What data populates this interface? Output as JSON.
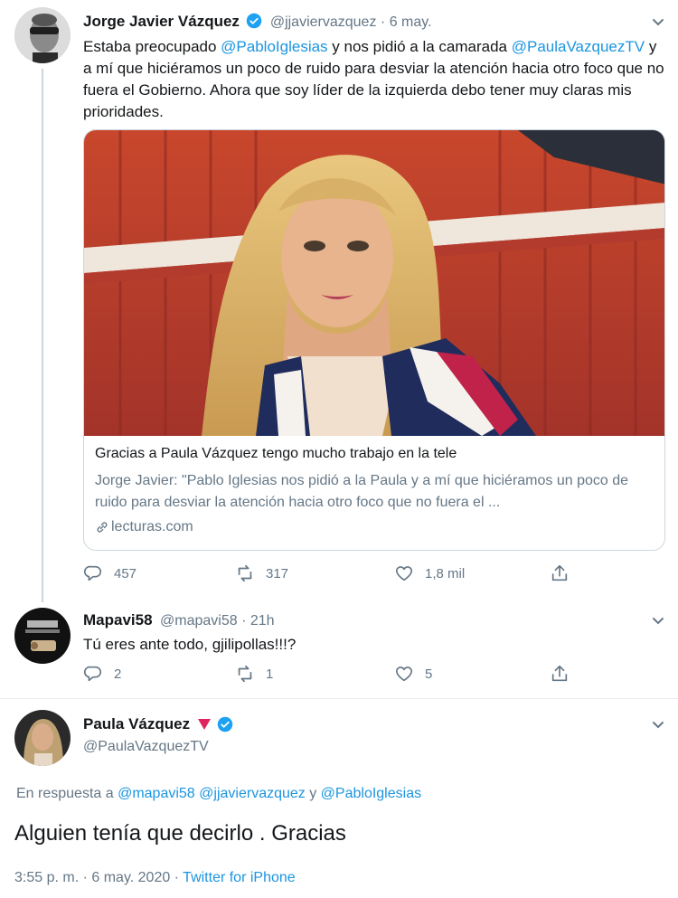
{
  "tweet1": {
    "name": "Jorge Javier Vázquez",
    "handle": "@jjaviervazquez",
    "dot": "·",
    "date": "6 may.",
    "text_1": "Estaba preocupado ",
    "mention_1": "@PabloIglesias",
    "text_2": " y nos pidió a la camarada ",
    "mention_2": "@PaulaVazquezTV",
    "text_3": " y a mí que hiciéramos un poco de ruido para desviar la atención hacia otro foco que no fuera el Gobierno. Ahora que soy líder de la izquierda debo tener muy claras mis prioridades.",
    "card": {
      "title": "Gracias a Paula Vázquez tengo mucho trabajo en la tele",
      "description": "Jorge Javier: \"Pablo Iglesias nos pidió a la Paula y a mí que hiciéramos un poco de ruido para desviar la atención hacia otro foco que no fuera el ...",
      "domain": "lecturas.com"
    },
    "replies": "457",
    "retweets": "317",
    "likes": "1,8 mil"
  },
  "tweet2": {
    "name": "Mapavi58",
    "handle": "@mapavi58",
    "dot": "·",
    "time": "21h",
    "text": "Tú eres ante todo, gjilipollas!!!?",
    "replies": "2",
    "retweets": "1",
    "likes": "5"
  },
  "tweet3": {
    "name": "Paula Vázquez",
    "handle": "@PaulaVazquezTV",
    "reply_prefix": "En respuesta a ",
    "reply_mention_1": "@mapavi58",
    "reply_mention_2": "@jjaviervazquez",
    "reply_and": " y ",
    "reply_mention_3": "@PabloIglesias",
    "text": "Alguien tenía que decirlo . Gracias",
    "timestamp": "3:55 p. m. · 6 may. 2020",
    "dot": " · ",
    "source": "Twitter for iPhone"
  },
  "colors": {
    "accent": "#1b95e0",
    "muted": "#657786",
    "verified": "#1da1f2",
    "flag": "#e0245e"
  },
  "icons": [
    "reply-icon",
    "retweet-icon",
    "like-icon",
    "share-icon",
    "verified-icon",
    "caret-down-icon",
    "link-icon",
    "red-triangle-icon"
  ]
}
